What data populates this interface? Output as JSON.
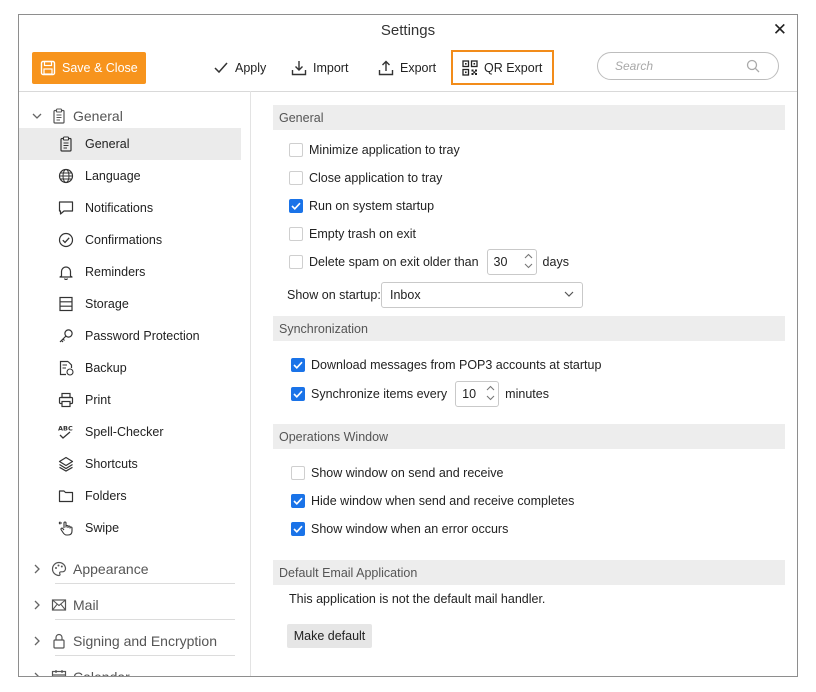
{
  "window": {
    "title": "Settings"
  },
  "toolbar": {
    "save_close": "Save & Close",
    "apply": "Apply",
    "import": "Import",
    "export": "Export",
    "qr_export": "QR Export",
    "search_placeholder": "Search"
  },
  "sidebar": {
    "general_group": "General",
    "items": [
      {
        "label": "General",
        "icon": "clipboard-icon"
      },
      {
        "label": "Language",
        "icon": "globe-icon"
      },
      {
        "label": "Notifications",
        "icon": "chat-bubble-icon"
      },
      {
        "label": "Confirmations",
        "icon": "check-circle-icon"
      },
      {
        "label": "Reminders",
        "icon": "bell-icon"
      },
      {
        "label": "Storage",
        "icon": "database-icon"
      },
      {
        "label": "Password Protection",
        "icon": "key-icon"
      },
      {
        "label": "Backup",
        "icon": "backup-icon"
      },
      {
        "label": "Print",
        "icon": "printer-icon"
      },
      {
        "label": "Spell-Checker",
        "icon": "spell-check-icon"
      },
      {
        "label": "Shortcuts",
        "icon": "layers-icon"
      },
      {
        "label": "Folders",
        "icon": "folder-icon"
      },
      {
        "label": "Swipe",
        "icon": "swipe-hand-icon"
      }
    ],
    "groups": [
      {
        "label": "Appearance",
        "icon": "palette-icon"
      },
      {
        "label": "Mail",
        "icon": "envelope-icon"
      },
      {
        "label": "Signing and Encryption",
        "icon": "lock-icon"
      },
      {
        "label": "Calendar",
        "icon": "calendar-icon"
      }
    ]
  },
  "content": {
    "general": {
      "header": "General",
      "minimize_tray": {
        "label": "Minimize application to tray",
        "checked": false
      },
      "close_tray": {
        "label": "Close application to tray",
        "checked": false
      },
      "run_startup": {
        "label": "Run on system startup",
        "checked": true
      },
      "empty_trash": {
        "label": "Empty trash on exit",
        "checked": false
      },
      "delete_spam": {
        "label": "Delete spam on exit older than",
        "checked": false,
        "value": "30",
        "unit": "days"
      },
      "show_on_startup": {
        "label": "Show on startup:",
        "value": "Inbox"
      }
    },
    "sync": {
      "header": "Synchronization",
      "download_pop3": {
        "label": "Download messages from POP3 accounts at startup",
        "checked": true
      },
      "sync_every": {
        "label": "Synchronize items every",
        "checked": true,
        "value": "10",
        "unit": "minutes"
      }
    },
    "ops": {
      "header": "Operations Window",
      "show_send_receive": {
        "label": "Show window on send and receive",
        "checked": false
      },
      "hide_complete": {
        "label": "Hide window when send and receive completes",
        "checked": true
      },
      "show_error": {
        "label": "Show window when an error occurs",
        "checked": true
      }
    },
    "default_email": {
      "header": "Default Email Application",
      "message": "This application is not the default mail handler.",
      "button": "Make default"
    }
  },
  "colors": {
    "accent": "#f7941d",
    "checkbox": "#1a73e8",
    "highlight": "#f28c1a"
  }
}
